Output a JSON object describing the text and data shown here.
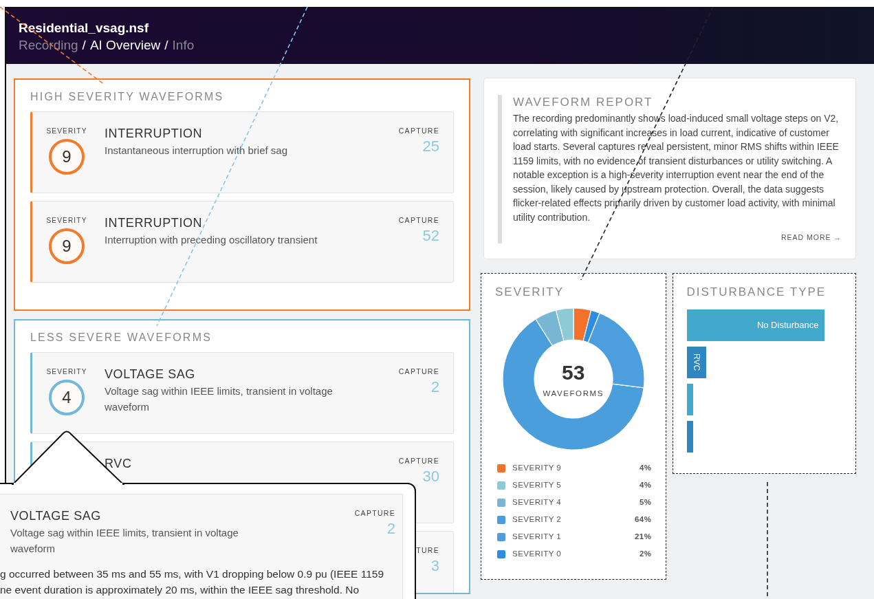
{
  "header": {
    "title": "Residential_vsag.nsf",
    "breadcrumb": [
      {
        "kind": "link",
        "label": "Recording",
        "selected": false
      },
      {
        "kind": "separator",
        "label": "/"
      },
      {
        "kind": "link",
        "label": "AI Overview",
        "selected": true
      },
      {
        "kind": "separator",
        "label": "/"
      },
      {
        "kind": "link",
        "label": "Info",
        "selected": false
      }
    ]
  },
  "sections": [
    {
      "title": "HIGH SEVERITY WAVEFORMS",
      "color": "#f47a2c",
      "waveforms": [
        {
          "severity_label": "SEVERITY",
          "severity": "9",
          "title": "INTERRUPTION",
          "description": "Instantaneous interruption with brief sag",
          "capture_label": "CAPTURE",
          "capture": "25"
        },
        {
          "severity_label": "SEVERITY",
          "severity": "9",
          "title": "INTERRUPTION",
          "description": "Interruption with preceding oscillatory transient",
          "capture_label": "CAPTURE",
          "capture": "52"
        }
      ]
    },
    {
      "title": "LESS SEVERE WAVEFORMS",
      "color": "#73b8d8",
      "waveforms": [
        {
          "severity_label": "SEVERITY",
          "severity": "4",
          "title": "VOLTAGE SAG",
          "description": "Voltage sag within IEEE limits, transient in voltage waveform",
          "capture_label": "CAPTURE",
          "capture": "2"
        },
        {
          "title": "RVC",
          "capture_label": "CAPTURE",
          "capture": "30"
        },
        {
          "capture_label": "TURE",
          "capture": "3"
        }
      ]
    }
  ],
  "report": {
    "title": "WAVEFORM REPORT",
    "text": "The recording predominantly shows load-induced small voltage steps on V2, correlating with significant increases in load current, indicative of customer load starts. Several captures reveal persistent, minor RMS shifts within IEEE 1159 limits, with no evidence of transient disturbances or utility switching. A notable exception is a high-severity interruption event near the end of the session, likely caused by upstream protection. Overall, the data suggests flicker-related effects primarily driven by customer load activity, with minimal utility contribution.",
    "link": "READ MORE →"
  },
  "severity_panel": {
    "title": "SEVERITY",
    "total": "53",
    "total_label": "WAVEFORMS",
    "chart_data": {
      "type": "donut",
      "categories": [
        "SEVERITY 9",
        "SEVERITY 5",
        "SEVERITY 4",
        "SEVERITY 2",
        "SEVERITY 1",
        "SEVERITY 0"
      ],
      "series": [
        {
          "values": [
            4,
            4,
            5,
            64,
            21,
            2
          ]
        }
      ]
    },
    "legend": [
      {
        "value": "4%",
        "color": "#f4722b"
      },
      {
        "value": "4%",
        "color": "#8ec9d6"
      },
      {
        "value": "5%",
        "color": "#77b7d4"
      },
      {
        "value": "64%",
        "color": "#4a9edb"
      },
      {
        "value": "21%",
        "color": "#4c9fdc"
      },
      {
        "value": "2%",
        "color": "#2f8ddf"
      }
    ]
  },
  "disturbance_panel": {
    "title": "DISTURBANCE TYPE",
    "bars": [
      {
        "label": "No Disturbance",
        "color": "#42a8cc"
      },
      {
        "label": "RVC",
        "color": "#2f87bd"
      },
      {
        "color": "#42a8cc"
      },
      {
        "color": "#2f87bd"
      }
    ]
  },
  "popover": {
    "title": "VOLTAGE SAG",
    "description": "Voltage sag within IEEE limits, transient in voltage waveform",
    "capture_label": "CAPTURE",
    "capture": "2",
    "lines": [
      "g occurred between 35 ms and 55 ms, with V1 dropping below 0.9 pu (IEEE 1159",
      "ne event duration is approximately 20 ms, within the IEEE sag threshold. No"
    ]
  }
}
